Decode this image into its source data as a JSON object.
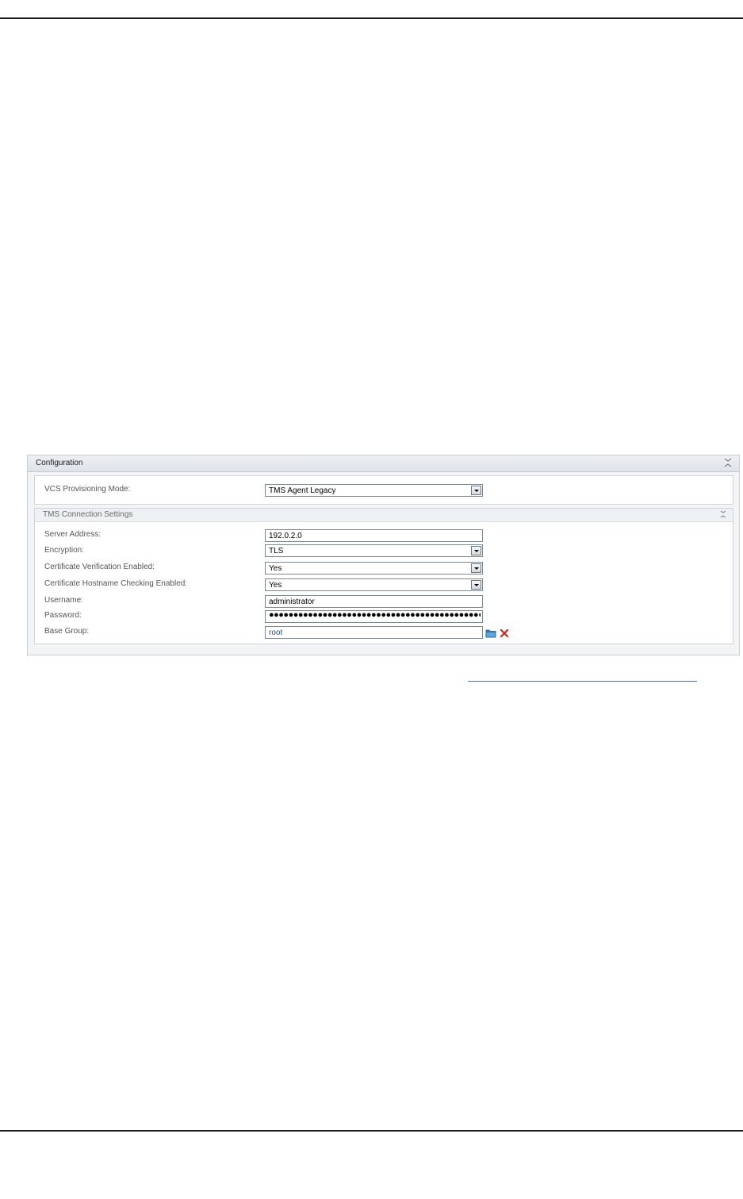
{
  "panel": {
    "title": "Configuration",
    "collapse_icon": "double-chevron-icon"
  },
  "mode": {
    "label": "VCS Provisioning Mode:",
    "value": "TMS Agent Legacy"
  },
  "tms_connection": {
    "title": "TMS Connection Settings",
    "collapse_icon": "double-chevron-icon",
    "fields": {
      "server_address": {
        "label": "Server Address:",
        "value": "192.0.2.0"
      },
      "encryption": {
        "label": "Encryption:",
        "value": "TLS"
      },
      "cert_verification": {
        "label": "Certificate Verification Enabled:",
        "value": "Yes"
      },
      "hostname_checking": {
        "label": "Certificate Hostname Checking Enabled:",
        "value": "Yes"
      },
      "username": {
        "label": "Username:",
        "value": "administrator"
      },
      "password": {
        "label": "Password:",
        "value": "●●●●●●●●●●●●●●●●●●●●●●●●●●●●●●●●●●●●●●●●●●●●●●●●●●●●●●"
      },
      "base_group": {
        "label": "Base Group:",
        "value": "root",
        "browse_icon": "folder-icon",
        "clear_icon": "red-x-icon"
      }
    }
  }
}
